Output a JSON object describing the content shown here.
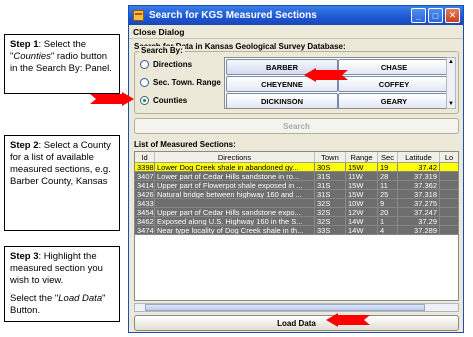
{
  "steps": [
    {
      "label": "Step 1",
      "text_a": ": Select the \"",
      "italic": "Counties",
      "text_b": "\" radio button in the Search By: Panel."
    },
    {
      "label": "Step 2",
      "text": ": Select a County for a list of available measured sections, e.g. Barber County, Kansas"
    },
    {
      "label": "Step 3",
      "text": ": Highlight the measured section you wish to view.",
      "text2_a": "Select the \"",
      "italic2": "Load Data",
      "text2_b": "\" Button."
    }
  ],
  "window": {
    "title": "Search for KGS Measured Sections",
    "menu": "Close Dialog",
    "subtitle": "Search for Data in Kansas Geological Survey Database:",
    "search_by_legend": "Search By:",
    "radios": [
      {
        "label": "Directions",
        "selected": false
      },
      {
        "label": "Sec. Town. Range",
        "selected": false
      },
      {
        "label": "Counties",
        "selected": true
      }
    ],
    "counties": [
      "BARBER",
      "CHASE",
      "CHEYENNE",
      "COFFEY",
      "DICKINSON",
      "GEARY"
    ],
    "search_button": "Search",
    "list_label": "List of Measured Sections:",
    "columns": [
      "Id",
      "Directions",
      "Town",
      "Range",
      "Sec",
      "Latitude",
      "Lo"
    ],
    "rows": [
      [
        "3398",
        "Lower Dog Creek shale in abandoned gy...",
        "30S",
        "15W",
        "19",
        "37.42"
      ],
      [
        "3407",
        "Lower part of Cedar Hills sandstone in ro...",
        "31S",
        "11W",
        "28",
        "37.319"
      ],
      [
        "3414",
        "Upper part of Flowerpot shale exposed in ...",
        "31S",
        "15W",
        "11",
        "37.362"
      ],
      [
        "3426",
        "Natural bridge between highway 160 and ...",
        "31S",
        "15W",
        "25",
        "37.318"
      ],
      [
        "3433",
        "",
        "32S",
        "10W",
        "9",
        "37.275"
      ],
      [
        "3454",
        "Upper part of Cedar Hills sandstone expo...",
        "32S",
        "12W",
        "20",
        "37.247"
      ],
      [
        "3462",
        "Exposed along U.S. Highway 160 in the S...",
        "32S",
        "14W",
        "1",
        "37.29"
      ],
      [
        "3474",
        "Near type locality of Dog Creek shale in th...",
        "33S",
        "14W",
        "4",
        "37.289"
      ]
    ],
    "load_button": "Load Data"
  },
  "colors": {
    "arrow": "#ff0000",
    "highlight_row": "#ffff00",
    "row_bg": "#6e6e6e",
    "title_bar": "#1d56d4"
  }
}
